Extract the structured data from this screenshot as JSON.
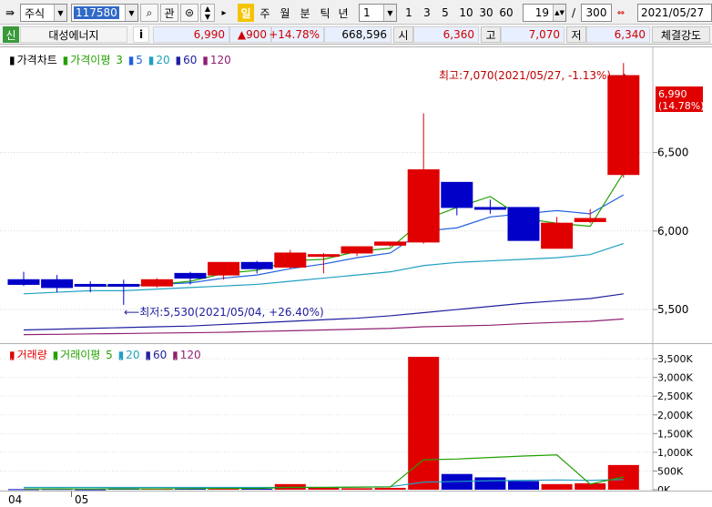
{
  "toolbar": {
    "market_select": "주식",
    "code_value": "117580",
    "search_icon": "search-icon",
    "tabs": [
      {
        "label": "관"
      }
    ],
    "periods": [
      "일",
      "주",
      "월",
      "분",
      "틱",
      "년"
    ],
    "active_period": "일",
    "unit_value": "1",
    "quick_units": [
      "1",
      "3",
      "5",
      "10",
      "30",
      "60"
    ],
    "count_value": "19",
    "separator": "/",
    "total_value": "300",
    "date_value": "2021/05/27"
  },
  "infobar": {
    "badge": "신",
    "name": "대성에너지",
    "info_button": "i",
    "price": "6,990",
    "change": "▲900",
    "change_pct": "+14.78%",
    "volume": "668,596",
    "open_label": "시",
    "open": "6,360",
    "high_label": "고",
    "high": "7,070",
    "low_label": "저",
    "low": "6,340",
    "strength_label": "체결강도"
  },
  "price_panel": {
    "legend": {
      "main": "가격차트",
      "ma_label": "가격이평",
      "ma_periods": [
        "3",
        "5",
        "20",
        "60",
        "120"
      ]
    },
    "max_annotation": "최고:7,070(2021/05/27, -1.13%)⟶",
    "min_annotation": "⟵최저:5,530(2021/05/04, +26.40%)",
    "current_label": "6,990",
    "current_pct": "(14.78%)",
    "y_ticks": [
      "6,500",
      "6,000",
      "5,500"
    ]
  },
  "volume_panel": {
    "legend": {
      "main": "거래량",
      "ma_label": "거래이평",
      "ma_periods": [
        "5",
        "20",
        "60",
        "120"
      ]
    },
    "y_ticks": [
      "3,500K",
      "3,000K",
      "2,500K",
      "2,000K",
      "1,500K",
      "1,000K",
      "500K",
      "0K"
    ]
  },
  "x_axis": {
    "labels": [
      "04",
      "05"
    ]
  },
  "colors": {
    "up": "#e00000",
    "down": "#0000c8",
    "ma3": "#22a000",
    "ma5": "#2060e0",
    "ma20": "#20a0c0",
    "ma60": "#2020a0",
    "ma120": "#902070"
  },
  "chart_data": {
    "type": "candlestick",
    "candles": [
      {
        "o": 5690,
        "h": 5740,
        "l": 5650,
        "c": 5660
      },
      {
        "o": 5690,
        "h": 5720,
        "l": 5610,
        "c": 5640
      },
      {
        "o": 5660,
        "h": 5680,
        "l": 5610,
        "c": 5650
      },
      {
        "o": 5660,
        "h": 5690,
        "l": 5530,
        "c": 5650
      },
      {
        "o": 5650,
        "h": 5700,
        "l": 5640,
        "c": 5690
      },
      {
        "o": 5730,
        "h": 5740,
        "l": 5660,
        "c": 5700
      },
      {
        "o": 5720,
        "h": 5800,
        "l": 5690,
        "c": 5800
      },
      {
        "o": 5800,
        "h": 5810,
        "l": 5730,
        "c": 5760
      },
      {
        "o": 5770,
        "h": 5880,
        "l": 5760,
        "c": 5860
      },
      {
        "o": 5840,
        "h": 5860,
        "l": 5730,
        "c": 5850
      },
      {
        "o": 5860,
        "h": 5900,
        "l": 5840,
        "c": 5900
      },
      {
        "o": 5910,
        "h": 5930,
        "l": 5900,
        "c": 5930
      },
      {
        "o": 5930,
        "h": 6750,
        "l": 5920,
        "c": 6390
      },
      {
        "o": 6310,
        "h": 6310,
        "l": 6100,
        "c": 6150
      },
      {
        "o": 6150,
        "h": 6200,
        "l": 6110,
        "c": 6140
      },
      {
        "o": 6150,
        "h": 6150,
        "l": 5940,
        "c": 5940
      },
      {
        "o": 5890,
        "h": 6090,
        "l": 5890,
        "c": 6050
      },
      {
        "o": 6060,
        "h": 6140,
        "l": 6050,
        "c": 6080
      },
      {
        "o": 6360,
        "h": 7070,
        "l": 6340,
        "c": 6990
      }
    ],
    "ma3": [
      null,
      null,
      5650,
      5650,
      5660,
      5680,
      5730,
      5750,
      5810,
      5820,
      5870,
      5890,
      6070,
      6150,
      6220,
      6080,
      6050,
      6030,
      6370
    ],
    "ma5": [
      null,
      null,
      null,
      null,
      5660,
      5670,
      5700,
      5720,
      5760,
      5790,
      5830,
      5860,
      6000,
      6020,
      6090,
      6110,
      6130,
      6110,
      6230
    ],
    "ma20": [
      5600,
      5610,
      5620,
      5620,
      5630,
      5640,
      5650,
      5660,
      5680,
      5700,
      5720,
      5740,
      5780,
      5800,
      5810,
      5820,
      5830,
      5850,
      5920
    ],
    "ma60": [
      5370,
      5375,
      5380,
      5385,
      5390,
      5395,
      5405,
      5415,
      5425,
      5435,
      5445,
      5460,
      5480,
      5500,
      5520,
      5540,
      5555,
      5570,
      5600
    ],
    "ma120": [
      5340,
      5342,
      5345,
      5347,
      5350,
      5352,
      5355,
      5360,
      5365,
      5370,
      5375,
      5380,
      5390,
      5395,
      5400,
      5410,
      5418,
      5425,
      5440
    ],
    "volume": [
      15,
      20,
      10,
      40,
      30,
      40,
      35,
      25,
      150,
      60,
      40,
      50,
      3550,
      420,
      330,
      230,
      150,
      170,
      660
    ],
    "volume_ma5": [
      20,
      22,
      20,
      25,
      23,
      29,
      35,
      34,
      64,
      62,
      70,
      75,
      800,
      820,
      860,
      900,
      930,
      150,
      340
    ],
    "volume_ma20": [
      60,
      60,
      60,
      60,
      60,
      60,
      60,
      60,
      60,
      60,
      70,
      80,
      200,
      220,
      240,
      250,
      260,
      250,
      270
    ],
    "ylim_price": [
      5280,
      7170
    ],
    "ylim_volume": [
      0,
      3600
    ]
  }
}
